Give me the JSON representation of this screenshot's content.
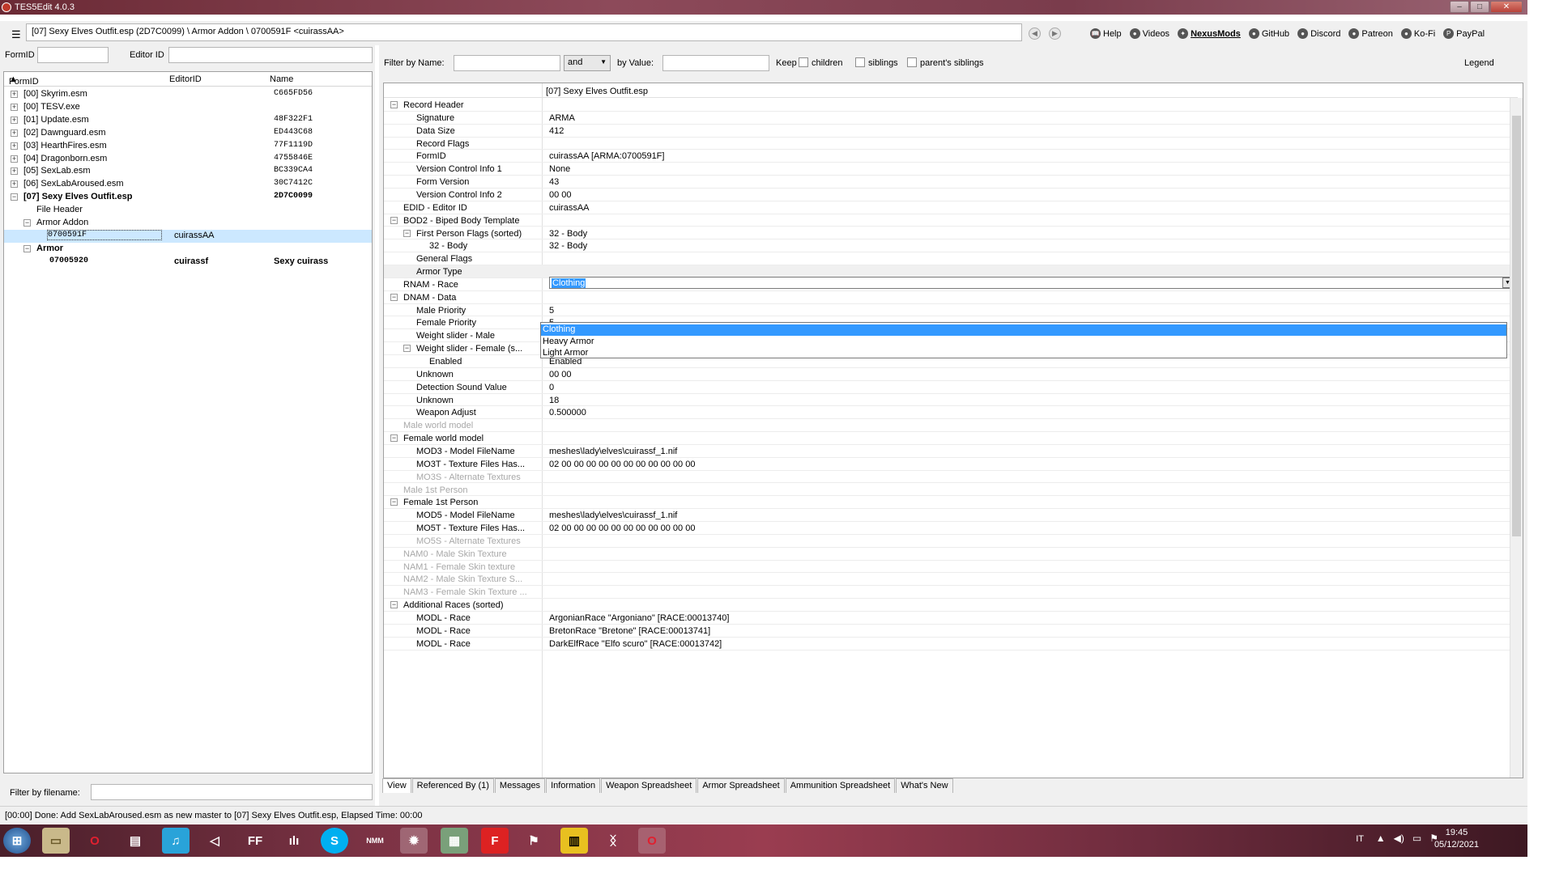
{
  "window": {
    "title": "TES5Edit 4.0.3",
    "min": "–",
    "max": "□",
    "close": "✕"
  },
  "path": "[07] Sexy Elves Outfit.esp (2D7C0099) \\ Armor Addon \\ 0700591F <cuirassAA>",
  "toplinks": [
    {
      "label": "Help",
      "icon": "book-icon"
    },
    {
      "label": "Videos",
      "icon": "videos-icon"
    },
    {
      "label": "NexusMods",
      "icon": "nexusmods-icon"
    },
    {
      "label": "GitHub",
      "icon": "github-icon"
    },
    {
      "label": "Discord",
      "icon": "discord-icon"
    },
    {
      "label": "Patreon",
      "icon": "patreon-icon"
    },
    {
      "label": "Ko-Fi",
      "icon": "kofi-icon"
    },
    {
      "label": "PayPal",
      "icon": "paypal-icon"
    }
  ],
  "left": {
    "formid_label": "FormID",
    "editorid_label": "Editor ID",
    "columns": [
      "FormID",
      "EditorID",
      "Name"
    ],
    "tree": [
      {
        "c1": "[00] Skyrim.esm",
        "c2": "",
        "c3": "C665FD56",
        "indent": 0,
        "toggle": "+"
      },
      {
        "c1": "[00] TESV.exe",
        "c2": "",
        "c3": "",
        "indent": 0,
        "toggle": "+"
      },
      {
        "c1": "[01] Update.esm",
        "c2": "",
        "c3": "48F322F1",
        "indent": 0,
        "toggle": "+"
      },
      {
        "c1": "[02] Dawnguard.esm",
        "c2": "",
        "c3": "ED443C68",
        "indent": 0,
        "toggle": "+"
      },
      {
        "c1": "[03] HearthFires.esm",
        "c2": "",
        "c3": "77F1119D",
        "indent": 0,
        "toggle": "+"
      },
      {
        "c1": "[04] Dragonborn.esm",
        "c2": "",
        "c3": "4755846E",
        "indent": 0,
        "toggle": "+"
      },
      {
        "c1": "[05] SexLab.esm",
        "c2": "",
        "c3": "BC339CA4",
        "indent": 0,
        "toggle": "+"
      },
      {
        "c1": "[06] SexLabAroused.esm",
        "c2": "",
        "c3": "30C7412C",
        "indent": 0,
        "toggle": "+"
      },
      {
        "c1": "[07] Sexy Elves Outfit.esp",
        "c2": "",
        "c3": "2D7C0099",
        "indent": 0,
        "toggle": "−",
        "bold": true
      },
      {
        "c1": "File Header",
        "c2": "",
        "c3": "",
        "indent": 1,
        "toggle": ""
      },
      {
        "c1": "Armor Addon",
        "c2": "",
        "c3": "",
        "indent": 1,
        "toggle": "−"
      },
      {
        "c1": "0700591F",
        "c2": "cuirassAA",
        "c3": "",
        "indent": 2,
        "toggle": "",
        "selected": true
      },
      {
        "c1": "Armor",
        "c2": "",
        "c3": "",
        "indent": 1,
        "toggle": "−",
        "bold": true
      },
      {
        "c1": "07005920",
        "c2": "cuirassf",
        "c3": "Sexy cuirass",
        "indent": 2,
        "toggle": "",
        "bold": true
      }
    ],
    "filter_label": "Filter by filename:"
  },
  "filter": {
    "by_name": "Filter by Name:",
    "op": "and",
    "by_value": "by Value:",
    "keep": "Keep",
    "children": "children",
    "siblings": "siblings",
    "parents_siblings": "parent's siblings",
    "legend": "Legend"
  },
  "grid": {
    "header": "[07] Sexy Elves Outfit.esp",
    "rows": [
      {
        "l": "Record Header",
        "v": "",
        "lv": 0,
        "tg": "−"
      },
      {
        "l": "Signature",
        "v": "ARMA",
        "lv": 1
      },
      {
        "l": "Data Size",
        "v": "412",
        "lv": 1
      },
      {
        "l": "Record Flags",
        "v": "",
        "lv": 1
      },
      {
        "l": "FormID",
        "v": "cuirassAA [ARMA:0700591F]",
        "lv": 1
      },
      {
        "l": "Version Control Info 1",
        "v": "None",
        "lv": 1
      },
      {
        "l": "Form Version",
        "v": "43",
        "lv": 1
      },
      {
        "l": "Version Control Info 2",
        "v": "00 00",
        "lv": 1
      },
      {
        "l": "EDID - Editor ID",
        "v": "cuirassAA",
        "lv": 0
      },
      {
        "l": "BOD2 - Biped Body Template",
        "v": "",
        "lv": 0,
        "tg": "−"
      },
      {
        "l": "First Person Flags (sorted)",
        "v": "32 - Body",
        "lv": 1,
        "tg": "−"
      },
      {
        "l": "32 - Body",
        "v": "32 - Body",
        "lv": 2
      },
      {
        "l": "General Flags",
        "v": "",
        "lv": 1
      },
      {
        "l": "Armor Type",
        "v": "",
        "lv": 1,
        "sel": true
      },
      {
        "l": "RNAM - Race",
        "v": "",
        "lv": 0
      },
      {
        "l": "DNAM - Data",
        "v": "",
        "lv": 0,
        "tg": "−"
      },
      {
        "l": "Male Priority",
        "v": "5",
        "lv": 1
      },
      {
        "l": "Female Priority",
        "v": "5",
        "lv": 1
      },
      {
        "l": "Weight slider - Male",
        "v": "",
        "lv": 1
      },
      {
        "l": "Weight slider - Female (s...",
        "v": "Enabled",
        "lv": 1,
        "tg": "−"
      },
      {
        "l": "Enabled",
        "v": "Enabled",
        "lv": 2
      },
      {
        "l": "Unknown",
        "v": "00 00",
        "lv": 1
      },
      {
        "l": "Detection Sound Value",
        "v": "0",
        "lv": 1
      },
      {
        "l": "Unknown",
        "v": "18",
        "lv": 1
      },
      {
        "l": "Weapon Adjust",
        "v": "0.500000",
        "lv": 1
      },
      {
        "l": "Male world model",
        "v": "",
        "lv": 0,
        "dim": true
      },
      {
        "l": "Female world model",
        "v": "",
        "lv": 0,
        "tg": "−"
      },
      {
        "l": "MOD3 - Model FileName",
        "v": "meshes\\lady\\elves\\cuirassf_1.nif",
        "lv": 1
      },
      {
        "l": "MO3T - Texture Files Has...",
        "v": "02 00 00 00 00 00 00 00 00 00 00 00",
        "lv": 1
      },
      {
        "l": "MO3S - Alternate Textures",
        "v": "",
        "lv": 1,
        "dim": true
      },
      {
        "l": "Male 1st Person",
        "v": "",
        "lv": 0,
        "dim": true
      },
      {
        "l": "Female 1st Person",
        "v": "",
        "lv": 0,
        "tg": "−"
      },
      {
        "l": "MOD5 - Model FileName",
        "v": "meshes\\lady\\elves\\cuirassf_1.nif",
        "lv": 1
      },
      {
        "l": "MO5T - Texture Files Has...",
        "v": "02 00 00 00 00 00 00 00 00 00 00 00",
        "lv": 1
      },
      {
        "l": "MO5S - Alternate Textures",
        "v": "",
        "lv": 1,
        "dim": true
      },
      {
        "l": "NAM0 - Male Skin Texture",
        "v": "",
        "lv": 0,
        "dim": true
      },
      {
        "l": "NAM1 - Female Skin texture",
        "v": "",
        "lv": 0,
        "dim": true
      },
      {
        "l": "NAM2 - Male Skin Texture S...",
        "v": "",
        "lv": 0,
        "dim": true
      },
      {
        "l": "NAM3 - Female Skin Texture ...",
        "v": "",
        "lv": 0,
        "dim": true
      },
      {
        "l": "Additional Races (sorted)",
        "v": "",
        "lv": 0,
        "tg": "−"
      },
      {
        "l": "MODL - Race",
        "v": "ArgonianRace \"Argoniano\" [RACE:00013740]",
        "lv": 1
      },
      {
        "l": "MODL - Race",
        "v": "BretonRace \"Bretone\" [RACE:00013741]",
        "lv": 1
      },
      {
        "l": "MODL - Race",
        "v": "DarkElfRace \"Elfo scuro\" [RACE:00013742]",
        "lv": 1
      }
    ]
  },
  "armor_type": {
    "value": "Clothing",
    "options": [
      "Clothing",
      "Heavy Armor",
      "Light Armor"
    ]
  },
  "tabs": [
    "View",
    "Referenced By (1)",
    "Messages",
    "Information",
    "Weapon Spreadsheet",
    "Armor Spreadsheet",
    "Ammunition Spreadsheet",
    "What's New"
  ],
  "status": "[00:00] Done: Add SexLabAroused.esm as new master to [07] Sexy Elves Outfit.esp, Elapsed Time: 00:00",
  "taskbar": {
    "lang": "IT",
    "time": "19:45",
    "date": "05/12/2021"
  }
}
